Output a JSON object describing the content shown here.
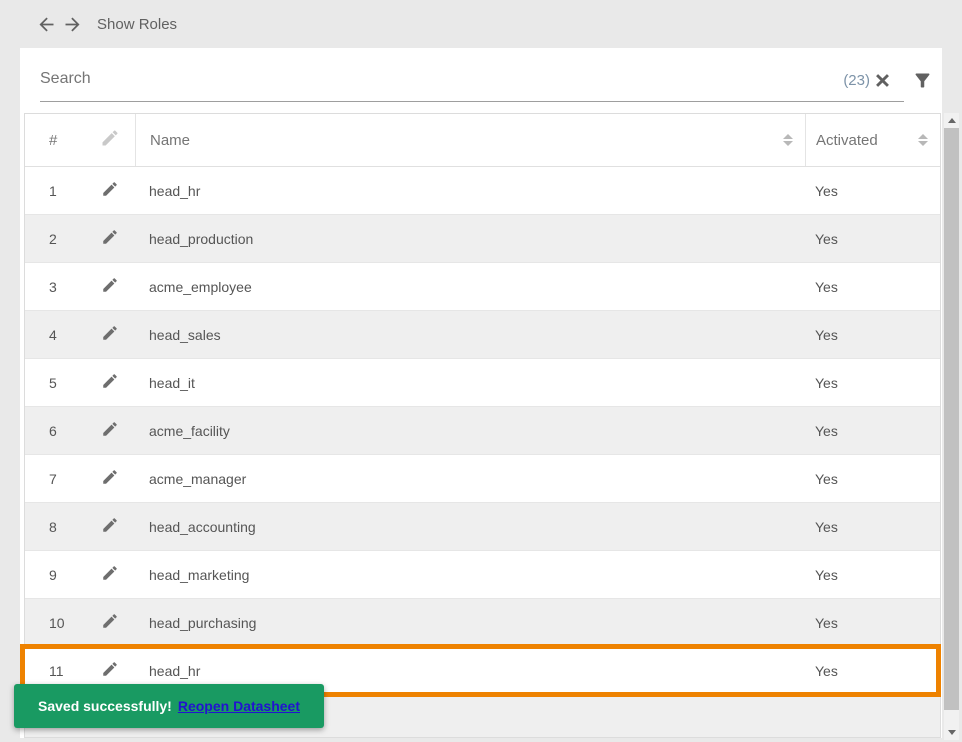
{
  "topbar": {
    "title": "Show Roles"
  },
  "search": {
    "placeholder": "Search",
    "count": "(23)"
  },
  "table": {
    "columns": {
      "index": "#",
      "name": "Name",
      "activated": "Activated"
    },
    "rows": [
      {
        "index": "1",
        "name": "head_hr",
        "activated": "Yes"
      },
      {
        "index": "2",
        "name": "head_production",
        "activated": "Yes"
      },
      {
        "index": "3",
        "name": "acme_employee",
        "activated": "Yes"
      },
      {
        "index": "4",
        "name": "head_sales",
        "activated": "Yes"
      },
      {
        "index": "5",
        "name": "head_it",
        "activated": "Yes"
      },
      {
        "index": "6",
        "name": "acme_facility",
        "activated": "Yes"
      },
      {
        "index": "7",
        "name": "acme_manager",
        "activated": "Yes"
      },
      {
        "index": "8",
        "name": "head_accounting",
        "activated": "Yes"
      },
      {
        "index": "9",
        "name": "head_marketing",
        "activated": "Yes"
      },
      {
        "index": "10",
        "name": "head_purchasing",
        "activated": "Yes"
      },
      {
        "index": "11",
        "name": "head_hr",
        "activated": "Yes",
        "highlighted": true
      }
    ],
    "partial_row_visible": true
  },
  "toast": {
    "message": "Saved successfully!",
    "link_label": "Reopen Datasheet"
  },
  "colors": {
    "highlight_border": "#ee8200",
    "toast_background": "#199a62",
    "toast_link": "#2213cf",
    "zebra_row": "#efefef"
  }
}
